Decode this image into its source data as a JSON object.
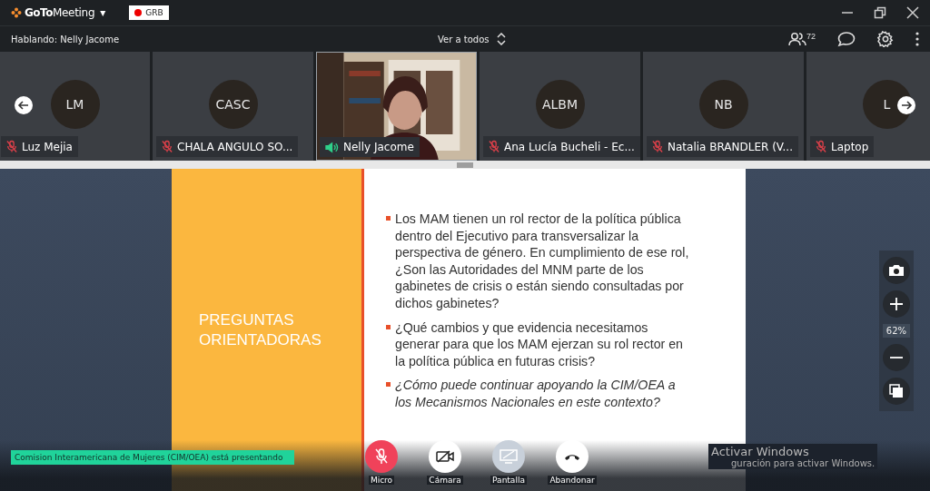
{
  "app": {
    "logo_bold": "GoTo",
    "logo_rest": "Meeting",
    "caret": "▾",
    "tag": "GRB"
  },
  "toolbar": {
    "speaking": "Hablando: Nelly Jacome",
    "view": "Ver a todos",
    "attendees": "72"
  },
  "participants": [
    {
      "initials": "LM",
      "name": "Luz Mejia",
      "kind": "avatar",
      "muted": true,
      "speaking": false,
      "selected": false
    },
    {
      "initials": "CASC",
      "name": "CHALA ANGULO SO...",
      "kind": "avatar",
      "muted": true,
      "speaking": false,
      "selected": false
    },
    {
      "name": "Nelly Jacome",
      "kind": "video",
      "muted": false,
      "speaking": true,
      "selected": true
    },
    {
      "initials": "ALBM",
      "name": "Ana Lucía Bucheli - Ec...",
      "kind": "avatar",
      "muted": true,
      "speaking": false,
      "selected": false
    },
    {
      "initials": "NB",
      "name": "Natalia BRANDLER (V...",
      "kind": "avatar",
      "muted": true,
      "speaking": false,
      "selected": false
    },
    {
      "initials": "L",
      "name": "Laptop",
      "kind": "avatar",
      "muted": true,
      "speaking": false,
      "selected": false
    }
  ],
  "slide": {
    "title": "PREGUNTAS ORIENTADORAS",
    "bullets": [
      {
        "text": "Los MAM tienen un rol rector de la política pública dentro del Ejecutivo para transversalizar la perspectiva de género. En cumplimiento de ese rol, ¿Son las Autoridades del MNM parte de los gabinetes de crisis o están siendo consultadas por dichos gabinetes?",
        "italic": false
      },
      {
        "text": "¿Qué cambios y que evidencia necesitamos generar para que los MAM ejerzan su rol rector en la política pública en futuras crisis?",
        "italic": false
      },
      {
        "text": "¿Cómo puede continuar apoyando la CIM/OEA a los Mecanismos Nacionales en este contexto?",
        "italic": true
      }
    ]
  },
  "zoom": {
    "value": "62%"
  },
  "presenter": "Comision Interamericana de Mujeres (CIM/OEA) está presentando",
  "controls": [
    {
      "label": "Micro",
      "kind": "mic",
      "disabled": false
    },
    {
      "label": "Cámara",
      "kind": "camera",
      "disabled": false
    },
    {
      "label": "Pantalla",
      "kind": "screen",
      "disabled": true
    },
    {
      "label": "Abandonar",
      "kind": "leave",
      "disabled": false
    }
  ],
  "os_notice": {
    "title": "Activar Windows",
    "text": "guración para activar Windows."
  }
}
